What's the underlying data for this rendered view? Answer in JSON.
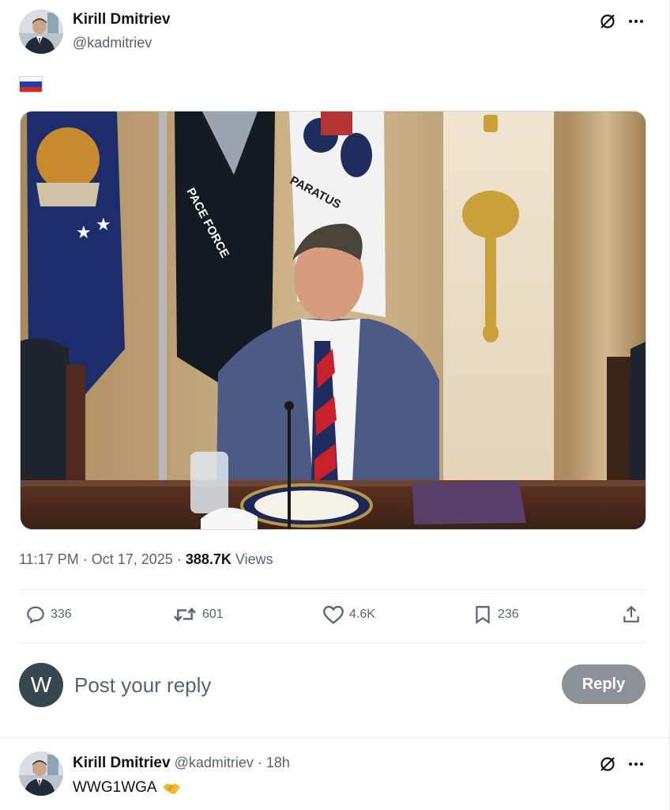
{
  "tweet": {
    "author_name": "Kirill Dmitriev",
    "author_handle": "@kadmitriev",
    "flag_emoji_name": "russia-flag",
    "flag_colors": [
      "#ffffff",
      "#1c3fb8",
      "#d52b1e"
    ],
    "image_flag_texts": [
      "PACE FORCE",
      "PARATUS"
    ],
    "time": "11:17 PM",
    "date": "Oct 17, 2025",
    "views_count": "388.7K",
    "views_label": "Views",
    "separator": "·"
  },
  "actions": {
    "replies": "336",
    "reposts": "601",
    "likes": "4.6K",
    "bookmarks": "236"
  },
  "composer": {
    "avatar_letter": "W",
    "placeholder": "Post your reply",
    "reply_button": "Reply"
  },
  "reply_tweet": {
    "author_name": "Kirill Dmitriev",
    "author_handle": "@kadmitriev",
    "separator": "·",
    "time": "18h",
    "text": "WWG1WGA",
    "emoji_name": "handshake-emoji"
  },
  "colors": {
    "text_primary": "#0f1419",
    "text_secondary": "#536471",
    "reply_button_bg": "#8b9196",
    "divider": "#e6e9ec"
  }
}
